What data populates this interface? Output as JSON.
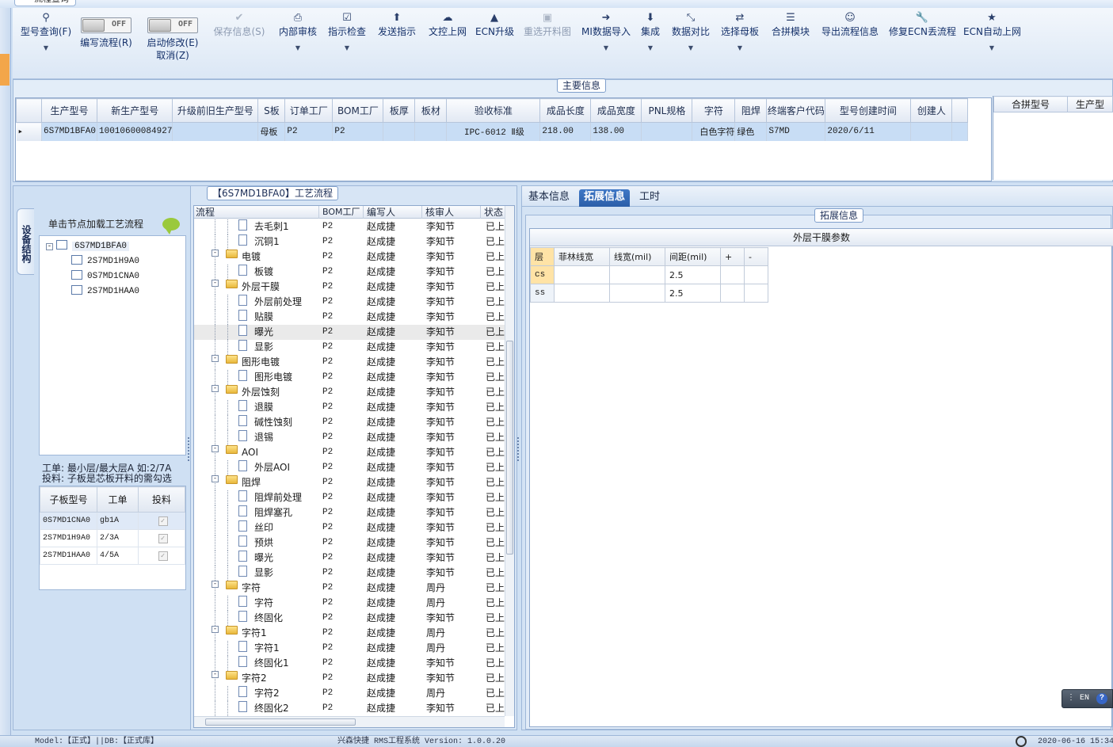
{
  "window": {
    "title": "流程查询"
  },
  "ribbon": {
    "buttons": [
      {
        "label": "型号查询(F)",
        "icon": "search-icon"
      },
      {
        "label": "保存信息(S)",
        "icon": "check-icon"
      },
      {
        "label": "内部审核",
        "icon": "print-icon"
      },
      {
        "label": "指示检查",
        "icon": "checkbox-icon"
      },
      {
        "label": "发送指示",
        "icon": "upload-icon"
      },
      {
        "label": "文控上网",
        "icon": "cloud-upload-icon"
      },
      {
        "label": "ECN升级",
        "icon": "rocket-icon"
      },
      {
        "label": "重选开料图",
        "icon": "image-icon"
      },
      {
        "label": "MI数据导入",
        "icon": "import-icon"
      },
      {
        "label": "集成",
        "icon": "download-icon"
      },
      {
        "label": "数据对比",
        "icon": "compress-icon"
      },
      {
        "label": "选择母板",
        "icon": "shuffle-icon"
      },
      {
        "label": "合拼模块",
        "icon": "list-icon"
      },
      {
        "label": "导出流程信息",
        "icon": "smile-icon"
      },
      {
        "label": "修复ECN丢流程",
        "icon": "wrench-icon"
      },
      {
        "label": "ECN自动上网",
        "icon": "star-icon"
      }
    ],
    "toggle1": {
      "label": "编写流程(R)",
      "state": "OFF"
    },
    "toggle2": {
      "label": "启动修改(E)",
      "sublabel": "取消(Z)",
      "state": "OFF"
    }
  },
  "main_info": {
    "title": "主要信息",
    "columns": [
      "生产型号",
      "新生产型号",
      "升级前旧生产型号",
      "S板",
      "订单工厂",
      "BOM工厂",
      "板厚",
      "板材",
      "验收标准",
      "成品长度",
      "成品宽度",
      "PNL规格",
      "字符",
      "阻焊",
      "终端客户代码",
      "型号创建时间",
      "创建人"
    ],
    "row": [
      "6S7MD1BFA0",
      "10010600084927",
      "",
      "母板",
      "P2",
      "P2",
      "",
      "",
      "IPC-6012 Ⅱ级",
      "218.00",
      "138.00",
      "",
      "白色字符",
      "绿色",
      "S7MD",
      "2020/6/11",
      ""
    ],
    "side_columns": [
      "合拼型号",
      "生产型"
    ]
  },
  "structure": {
    "tab_label": "设备结构",
    "header": "单击节点加载工艺流程",
    "root": "6S7MD1BFA0",
    "children": [
      "2S7MD1H9A0",
      "0S7MD1CNA0",
      "2S7MD1HAA0"
    ],
    "note1": "工单: 最小层/最大层A 如:2/7A",
    "note2": "投料: 子板是芯板开料的需勾选",
    "sub_columns": [
      "子板型号",
      "工单",
      "投料"
    ],
    "sub_rows": [
      {
        "model": "0S7MD1CNA0",
        "order": "gb1A",
        "feed": "✓"
      },
      {
        "model": "2S7MD1H9A0",
        "order": "2/3A",
        "feed": "✓"
      },
      {
        "model": "2S7MD1HAA0",
        "order": "4/5A",
        "feed": "✓"
      }
    ]
  },
  "process": {
    "title": "【6S7MD1BFA0】工艺流程",
    "columns": [
      "流程",
      "BOM工厂",
      "编写人",
      "核审人",
      "状态"
    ],
    "rows": [
      {
        "name": "去毛刺1",
        "level": 2,
        "bom": "P2",
        "writer": "赵成捷",
        "reviewer": "李知节",
        "status": "已上"
      },
      {
        "name": "沉铜1",
        "level": 2,
        "bom": "P2",
        "writer": "赵成捷",
        "reviewer": "李知节",
        "status": "已上"
      },
      {
        "name": "电镀",
        "level": 1,
        "bom": "P2",
        "writer": "赵成捷",
        "reviewer": "李知节",
        "status": "已上"
      },
      {
        "name": "板镀",
        "level": 2,
        "bom": "P2",
        "writer": "赵成捷",
        "reviewer": "李知节",
        "status": "已上"
      },
      {
        "name": "外层干膜",
        "level": 1,
        "bom": "P2",
        "writer": "赵成捷",
        "reviewer": "李知节",
        "status": "已上"
      },
      {
        "name": "外层前处理",
        "level": 2,
        "bom": "P2",
        "writer": "赵成捷",
        "reviewer": "李知节",
        "status": "已上"
      },
      {
        "name": "贴膜",
        "level": 2,
        "bom": "P2",
        "writer": "赵成捷",
        "reviewer": "李知节",
        "status": "已上"
      },
      {
        "name": "曝光",
        "level": 2,
        "bom": "P2",
        "writer": "赵成捷",
        "reviewer": "李知节",
        "status": "已上",
        "selected": true
      },
      {
        "name": "显影",
        "level": 2,
        "bom": "P2",
        "writer": "赵成捷",
        "reviewer": "李知节",
        "status": "已上"
      },
      {
        "name": "图形电镀",
        "level": 1,
        "bom": "P2",
        "writer": "赵成捷",
        "reviewer": "李知节",
        "status": "已上"
      },
      {
        "name": "图形电镀",
        "level": 2,
        "bom": "P2",
        "writer": "赵成捷",
        "reviewer": "李知节",
        "status": "已上"
      },
      {
        "name": "外层蚀刻",
        "level": 1,
        "bom": "P2",
        "writer": "赵成捷",
        "reviewer": "李知节",
        "status": "已上"
      },
      {
        "name": "退膜",
        "level": 2,
        "bom": "P2",
        "writer": "赵成捷",
        "reviewer": "李知节",
        "status": "已上"
      },
      {
        "name": "碱性蚀刻",
        "level": 2,
        "bom": "P2",
        "writer": "赵成捷",
        "reviewer": "李知节",
        "status": "已上"
      },
      {
        "name": "退锡",
        "level": 2,
        "bom": "P2",
        "writer": "赵成捷",
        "reviewer": "李知节",
        "status": "已上"
      },
      {
        "name": "AOI",
        "level": 1,
        "bom": "P2",
        "writer": "赵成捷",
        "reviewer": "李知节",
        "status": "已上"
      },
      {
        "name": "外层AOI",
        "level": 2,
        "bom": "P2",
        "writer": "赵成捷",
        "reviewer": "李知节",
        "status": "已上"
      },
      {
        "name": "阻焊",
        "level": 1,
        "bom": "P2",
        "writer": "赵成捷",
        "reviewer": "李知节",
        "status": "已上"
      },
      {
        "name": "阻焊前处理",
        "level": 2,
        "bom": "P2",
        "writer": "赵成捷",
        "reviewer": "李知节",
        "status": "已上"
      },
      {
        "name": "阻焊塞孔",
        "level": 2,
        "bom": "P2",
        "writer": "赵成捷",
        "reviewer": "李知节",
        "status": "已上"
      },
      {
        "name": "丝印",
        "level": 2,
        "bom": "P2",
        "writer": "赵成捷",
        "reviewer": "李知节",
        "status": "已上"
      },
      {
        "name": "预烘",
        "level": 2,
        "bom": "P2",
        "writer": "赵成捷",
        "reviewer": "李知节",
        "status": "已上"
      },
      {
        "name": "曝光",
        "level": 2,
        "bom": "P2",
        "writer": "赵成捷",
        "reviewer": "李知节",
        "status": "已上"
      },
      {
        "name": "显影",
        "level": 2,
        "bom": "P2",
        "writer": "赵成捷",
        "reviewer": "李知节",
        "status": "已上"
      },
      {
        "name": "字符",
        "level": 1,
        "bom": "P2",
        "writer": "赵成捷",
        "reviewer": "周丹",
        "status": "已上"
      },
      {
        "name": "字符",
        "level": 2,
        "bom": "P2",
        "writer": "赵成捷",
        "reviewer": "周丹",
        "status": "已上"
      },
      {
        "name": "终固化",
        "level": 2,
        "bom": "P2",
        "writer": "赵成捷",
        "reviewer": "李知节",
        "status": "已上"
      },
      {
        "name": "字符1",
        "level": 1,
        "bom": "P2",
        "writer": "赵成捷",
        "reviewer": "周丹",
        "status": "已上"
      },
      {
        "name": "字符1",
        "level": 2,
        "bom": "P2",
        "writer": "赵成捷",
        "reviewer": "周丹",
        "status": "已上"
      },
      {
        "name": "终固化1",
        "level": 2,
        "bom": "P2",
        "writer": "赵成捷",
        "reviewer": "李知节",
        "status": "已上"
      },
      {
        "name": "字符2",
        "level": 1,
        "bom": "P2",
        "writer": "赵成捷",
        "reviewer": "李知节",
        "status": "已上"
      },
      {
        "name": "字符2",
        "level": 2,
        "bom": "P2",
        "writer": "赵成捷",
        "reviewer": "周丹",
        "status": "已上"
      },
      {
        "name": "终固化2",
        "level": 2,
        "bom": "P2",
        "writer": "赵成捷",
        "reviewer": "李知节",
        "status": "已上"
      }
    ]
  },
  "right_panel": {
    "tabs": [
      "基本信息",
      "拓展信息",
      "工时"
    ],
    "active_tab": "拓展信息",
    "section_title": "拓展信息",
    "param_title": "外层干膜参数",
    "param_columns": [
      "层",
      "菲林线宽",
      "线宽(mil)",
      "间距(mil)",
      "+",
      "-"
    ],
    "param_rows": [
      {
        "layer": "cs",
        "film": "",
        "width": "",
        "spacing": "2.5"
      },
      {
        "layer": "ss",
        "film": "",
        "width": "",
        "spacing": "2.5"
      }
    ]
  },
  "badge": {
    "lang": "EN",
    "help": "?"
  },
  "status_bar": {
    "model": "Model:【正式】||DB:【正式库】",
    "app": "兴森快捷 RMS工程系统 Version: 1.0.0.20",
    "datetime": "2020-06-16 15:34"
  }
}
